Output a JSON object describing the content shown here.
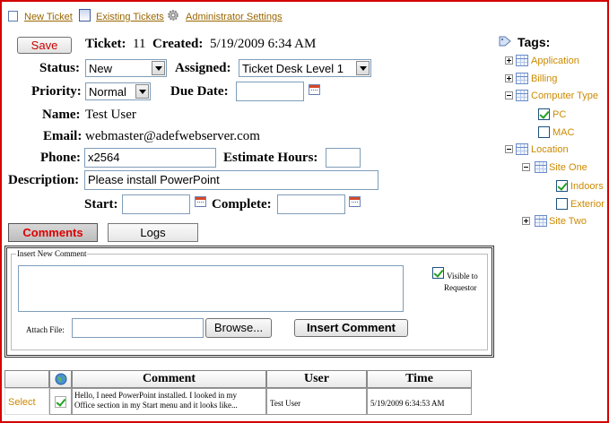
{
  "toolbar": {
    "new_ticket": "New Ticket",
    "existing_tickets": "Existing Tickets",
    "admin_settings": "Administrator Settings"
  },
  "ticket": {
    "save_label": "Save",
    "ticket_label": "Ticket:",
    "ticket_number": "11",
    "created_label": "Created:",
    "created_value": "5/19/2009 6:34 AM",
    "status_label": "Status:",
    "status_value": "New",
    "assigned_label": "Assigned:",
    "assigned_value": "Ticket Desk Level 1",
    "priority_label": "Priority:",
    "priority_value": "Normal",
    "due_date_label": "Due Date:",
    "due_date_value": "",
    "name_label": "Name:",
    "name_value": "Test User",
    "email_label": "Email:",
    "email_value": "webmaster@adefwebserver.com",
    "phone_label": "Phone:",
    "phone_value": "x2564",
    "estimate_label": "Estimate Hours:",
    "estimate_value": "",
    "description_label": "Description:",
    "description_value": "Please install PowerPoint",
    "start_label": "Start:",
    "start_value": "",
    "complete_label": "Complete:",
    "complete_value": ""
  },
  "tabs": {
    "comments": "Comments",
    "logs": "Logs",
    "active": "comments"
  },
  "comment_form": {
    "legend": "Insert New Comment",
    "comment_text": "",
    "visible_label_line1": "Visible to",
    "visible_label_line2": "Requestor",
    "visible_checked": true,
    "attach_label": "Attach File:",
    "attach_value": "",
    "browse_label": "Browse...",
    "insert_label": "Insert Comment"
  },
  "comments_table": {
    "headers": [
      "",
      "",
      "Comment",
      "User",
      "Time"
    ],
    "rows": [
      {
        "select": "Select",
        "visible": true,
        "comment_line1": "Hello, I need PowerPoint installed. I looked in my",
        "comment_line2": "Office section in my Start menu and it looks like...",
        "user": "Test User",
        "time": "5/19/2009 6:34:53 AM"
      }
    ]
  },
  "tags": {
    "title": "Tags:",
    "items": [
      {
        "label": "Application",
        "level": 0,
        "expander": "plus",
        "checkbox": false
      },
      {
        "label": "Billing",
        "level": 0,
        "expander": "plus",
        "checkbox": false
      },
      {
        "label": "Computer Type",
        "level": 0,
        "expander": "minus",
        "checkbox": false
      },
      {
        "label": "PC",
        "level": 1,
        "expander": "none",
        "checkbox": true,
        "checked": true
      },
      {
        "label": "MAC",
        "level": 1,
        "expander": "none",
        "checkbox": true,
        "checked": false
      },
      {
        "label": "Location",
        "level": 0,
        "expander": "minus",
        "checkbox": false
      },
      {
        "label": "Site One",
        "level": 1,
        "expander": "minus",
        "checkbox": false
      },
      {
        "label": "Indoors",
        "level": 2,
        "expander": "none",
        "checkbox": true,
        "checked": true
      },
      {
        "label": "Exterior",
        "level": 2,
        "expander": "none",
        "checkbox": true,
        "checked": false
      },
      {
        "label": "Site Two",
        "level": 1,
        "expander": "plus",
        "checkbox": false
      }
    ]
  },
  "colors": {
    "frame": "#d40000",
    "link": "#996600",
    "tag_link": "#cc8a00",
    "save_text": "#cc0000",
    "active_tab_text": "#dd0000"
  }
}
